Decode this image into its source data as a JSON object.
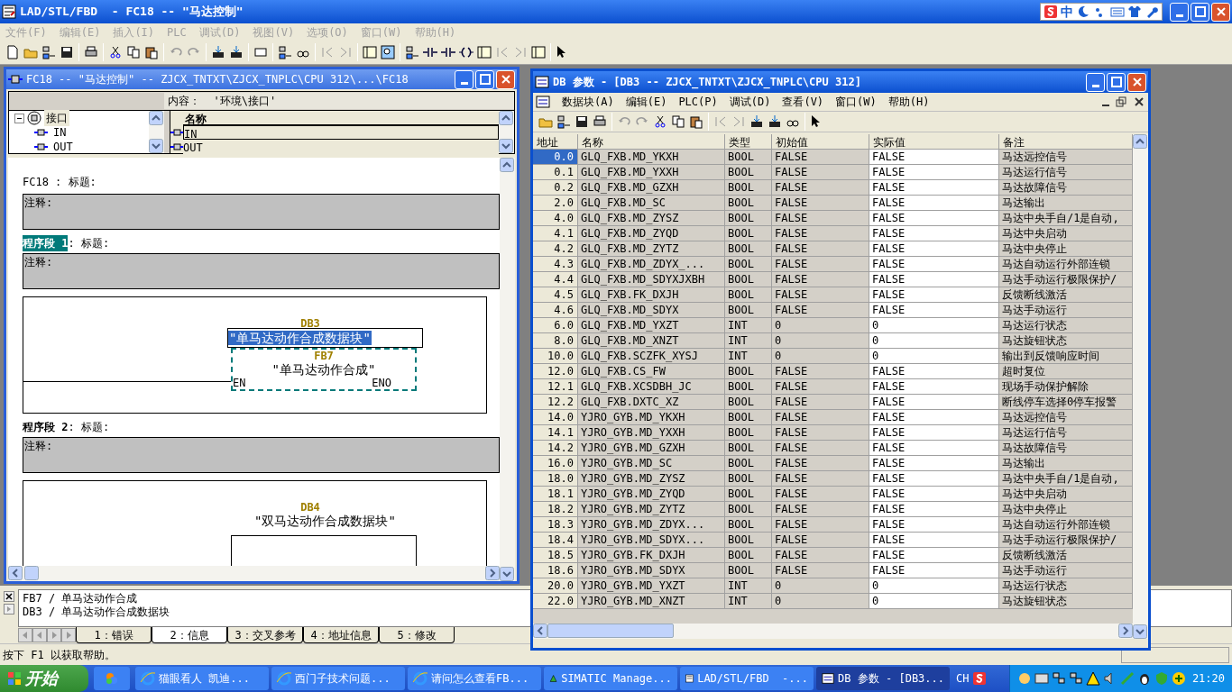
{
  "app": {
    "title": "LAD/STL/FBD  - FC18 -- \"马达控制\"",
    "menu": [
      "文件(F)",
      "编辑(E)",
      "插入(I)",
      "PLC",
      "调试(D)",
      "视图(V)",
      "选项(O)",
      "窗口(W)",
      "帮助(H)"
    ]
  },
  "ime_bar": {
    "mode": "中"
  },
  "fc_window": {
    "title": "FC18 -- \"马达控制\" -- ZJCX_TNTXT\\ZJCX_TNPLC\\CPU 312\\...\\FC18",
    "content_label": "内容：  '环境\\接口'",
    "tree": [
      {
        "label": "接口",
        "expanded": true,
        "selected": true,
        "children": [
          {
            "label": "IN",
            "selected": false
          },
          {
            "label": "OUT",
            "selected": false
          }
        ]
      }
    ],
    "interface_table": {
      "column": "名称",
      "rows": [
        {
          "label": "IN",
          "selected": true
        },
        {
          "label": "OUT",
          "selected": false
        }
      ]
    },
    "block_title": "FC18 : 标题:",
    "block_comment": "注释:",
    "networks": [
      {
        "label": "程序段 1",
        "title": ": 标题:",
        "selected": true,
        "comment": "注释:",
        "db": "DB3",
        "db_name": "\"单马达动作合成数据块\"",
        "db_name_selected": true,
        "fb": "FB7",
        "fb_name": "\"单马达动作合成\"",
        "en": "EN",
        "eno": "ENO"
      },
      {
        "label": "程序段 2",
        "title": ": 标题:",
        "selected": false,
        "comment": "注释:",
        "db": "DB4",
        "db_name": "\"双马达动作合成数据块\"",
        "db_name_selected": false
      }
    ]
  },
  "db_window": {
    "title": "DB 参数 - [DB3 -- ZJCX_TNTXT\\ZJCX_TNPLC\\CPU 312]",
    "menu": [
      "数据块(A)",
      "编辑(E)",
      "PLC(P)",
      "调试(D)",
      "查看(V)",
      "窗口(W)",
      "帮助(H)"
    ],
    "columns": [
      "地址",
      "名称",
      "类型",
      "初始值",
      "实际值",
      "备注"
    ],
    "rows": [
      {
        "cells": [
          "0.0",
          "GLQ_FXB.MD_YKXH",
          "BOOL",
          "FALSE",
          "FALSE",
          "马达远控信号"
        ],
        "selected": true
      },
      {
        "cells": [
          "0.1",
          "GLQ_FXB.MD_YXXH",
          "BOOL",
          "FALSE",
          "FALSE",
          "马达运行信号"
        ],
        "selected": false
      },
      {
        "cells": [
          "0.2",
          "GLQ_FXB.MD_GZXH",
          "BOOL",
          "FALSE",
          "FALSE",
          "马达故障信号"
        ],
        "selected": false
      },
      {
        "cells": [
          "2.0",
          "GLQ_FXB.MD_SC",
          "BOOL",
          "FALSE",
          "FALSE",
          "马达输出"
        ],
        "selected": false
      },
      {
        "cells": [
          "4.0",
          "GLQ_FXB.MD_ZYSZ",
          "BOOL",
          "FALSE",
          "FALSE",
          "马达中央手自/1是自动,"
        ],
        "selected": false
      },
      {
        "cells": [
          "4.1",
          "GLQ_FXB.MD_ZYQD",
          "BOOL",
          "FALSE",
          "FALSE",
          "马达中央启动"
        ],
        "selected": false
      },
      {
        "cells": [
          "4.2",
          "GLQ_FXB.MD_ZYTZ",
          "BOOL",
          "FALSE",
          "FALSE",
          "马达中央停止"
        ],
        "selected": false
      },
      {
        "cells": [
          "4.3",
          "GLQ_FXB.MD_ZDYX_...",
          "BOOL",
          "FALSE",
          "FALSE",
          "马达自动运行外部连锁"
        ],
        "selected": false
      },
      {
        "cells": [
          "4.4",
          "GLQ_FXB.MD_SDYXJXBH",
          "BOOL",
          "FALSE",
          "FALSE",
          "马达手动运行极限保护/"
        ],
        "selected": false
      },
      {
        "cells": [
          "4.5",
          "GLQ_FXB.FK_DXJH",
          "BOOL",
          "FALSE",
          "FALSE",
          "反馈断线激活"
        ],
        "selected": false
      },
      {
        "cells": [
          "4.6",
          "GLQ_FXB.MD_SDYX",
          "BOOL",
          "FALSE",
          "FALSE",
          "马达手动运行"
        ],
        "selected": false
      },
      {
        "cells": [
          "6.0",
          "GLQ_FXB.MD_YXZT",
          "INT",
          "0",
          "0",
          "马达运行状态"
        ],
        "selected": false
      },
      {
        "cells": [
          "8.0",
          "GLQ_FXB.MD_XNZT",
          "INT",
          "0",
          "0",
          "马达旋钮状态"
        ],
        "selected": false
      },
      {
        "cells": [
          "10.0",
          "GLQ_FXB.SCZFK_XYSJ",
          "INT",
          "0",
          "0",
          "输出到反馈响应时间"
        ],
        "selected": false
      },
      {
        "cells": [
          "12.0",
          "GLQ_FXB.CS_FW",
          "BOOL",
          "FALSE",
          "FALSE",
          "超时复位"
        ],
        "selected": false
      },
      {
        "cells": [
          "12.1",
          "GLQ_FXB.XCSDBH_JC",
          "BOOL",
          "FALSE",
          "FALSE",
          "现场手动保护解除"
        ],
        "selected": false
      },
      {
        "cells": [
          "12.2",
          "GLQ_FXB.DXTC_XZ",
          "BOOL",
          "FALSE",
          "FALSE",
          "断线停车选择0停车报警"
        ],
        "selected": false
      },
      {
        "cells": [
          "14.0",
          "YJRO_GYB.MD_YKXH",
          "BOOL",
          "FALSE",
          "FALSE",
          "马达远控信号"
        ],
        "selected": false
      },
      {
        "cells": [
          "14.1",
          "YJRO_GYB.MD_YXXH",
          "BOOL",
          "FALSE",
          "FALSE",
          "马达运行信号"
        ],
        "selected": false
      },
      {
        "cells": [
          "14.2",
          "YJRO_GYB.MD_GZXH",
          "BOOL",
          "FALSE",
          "FALSE",
          "马达故障信号"
        ],
        "selected": false
      },
      {
        "cells": [
          "16.0",
          "YJRO_GYB.MD_SC",
          "BOOL",
          "FALSE",
          "FALSE",
          "马达输出"
        ],
        "selected": false
      },
      {
        "cells": [
          "18.0",
          "YJRO_GYB.MD_ZYSZ",
          "BOOL",
          "FALSE",
          "FALSE",
          "马达中央手自/1是自动,"
        ],
        "selected": false
      },
      {
        "cells": [
          "18.1",
          "YJRO_GYB.MD_ZYQD",
          "BOOL",
          "FALSE",
          "FALSE",
          "马达中央启动"
        ],
        "selected": false
      },
      {
        "cells": [
          "18.2",
          "YJRO_GYB.MD_ZYTZ",
          "BOOL",
          "FALSE",
          "FALSE",
          "马达中央停止"
        ],
        "selected": false
      },
      {
        "cells": [
          "18.3",
          "YJRO_GYB.MD_ZDYX...",
          "BOOL",
          "FALSE",
          "FALSE",
          "马达自动运行外部连锁"
        ],
        "selected": false
      },
      {
        "cells": [
          "18.4",
          "YJRO_GYB.MD_SDYX...",
          "BOOL",
          "FALSE",
          "FALSE",
          "马达手动运行极限保护/"
        ],
        "selected": false
      },
      {
        "cells": [
          "18.5",
          "YJRO_GYB.FK_DXJH",
          "BOOL",
          "FALSE",
          "FALSE",
          "反馈断线激活"
        ],
        "selected": false
      },
      {
        "cells": [
          "18.6",
          "YJRO_GYB.MD_SDYX",
          "BOOL",
          "FALSE",
          "FALSE",
          "马达手动运行"
        ],
        "selected": false
      },
      {
        "cells": [
          "20.0",
          "YJRO_GYB.MD_YXZT",
          "INT",
          "0",
          "0",
          "马达运行状态"
        ],
        "selected": false
      },
      {
        "cells": [
          "22.0",
          "YJRO_GYB.MD_XNZT",
          "INT",
          "0",
          "0",
          "马达旋钮状态"
        ],
        "selected": false
      }
    ]
  },
  "output_panel": {
    "lines": [
      "FB7 / 单马达动作合成",
      "DB3 / 单马达动作合成数据块"
    ],
    "tabs": [
      {
        "label": "1：错误",
        "selected": false
      },
      {
        "label": "2：信息",
        "selected": true
      },
      {
        "label": "3：交叉参考",
        "selected": false
      },
      {
        "label": "4：地址信息",
        "selected": false
      },
      {
        "label": "5：修改",
        "selected": false
      }
    ]
  },
  "status_bar": {
    "text": "按下 F1 以获取帮助。"
  },
  "taskbar": {
    "start": "开始",
    "tasks": [
      {
        "label": "猫眼看人 凯迪...",
        "selected": false
      },
      {
        "label": "西门子技术问题...",
        "selected": false
      },
      {
        "label": "请问怎么查看FB...",
        "selected": false
      },
      {
        "label": "SIMATIC Manage...",
        "selected": false
      },
      {
        "label": "LAD/STL/FBD  -...",
        "selected": false
      },
      {
        "label": "DB 参数 - [DB3...",
        "selected": true
      }
    ],
    "language": "CH",
    "clock": "21:20"
  }
}
